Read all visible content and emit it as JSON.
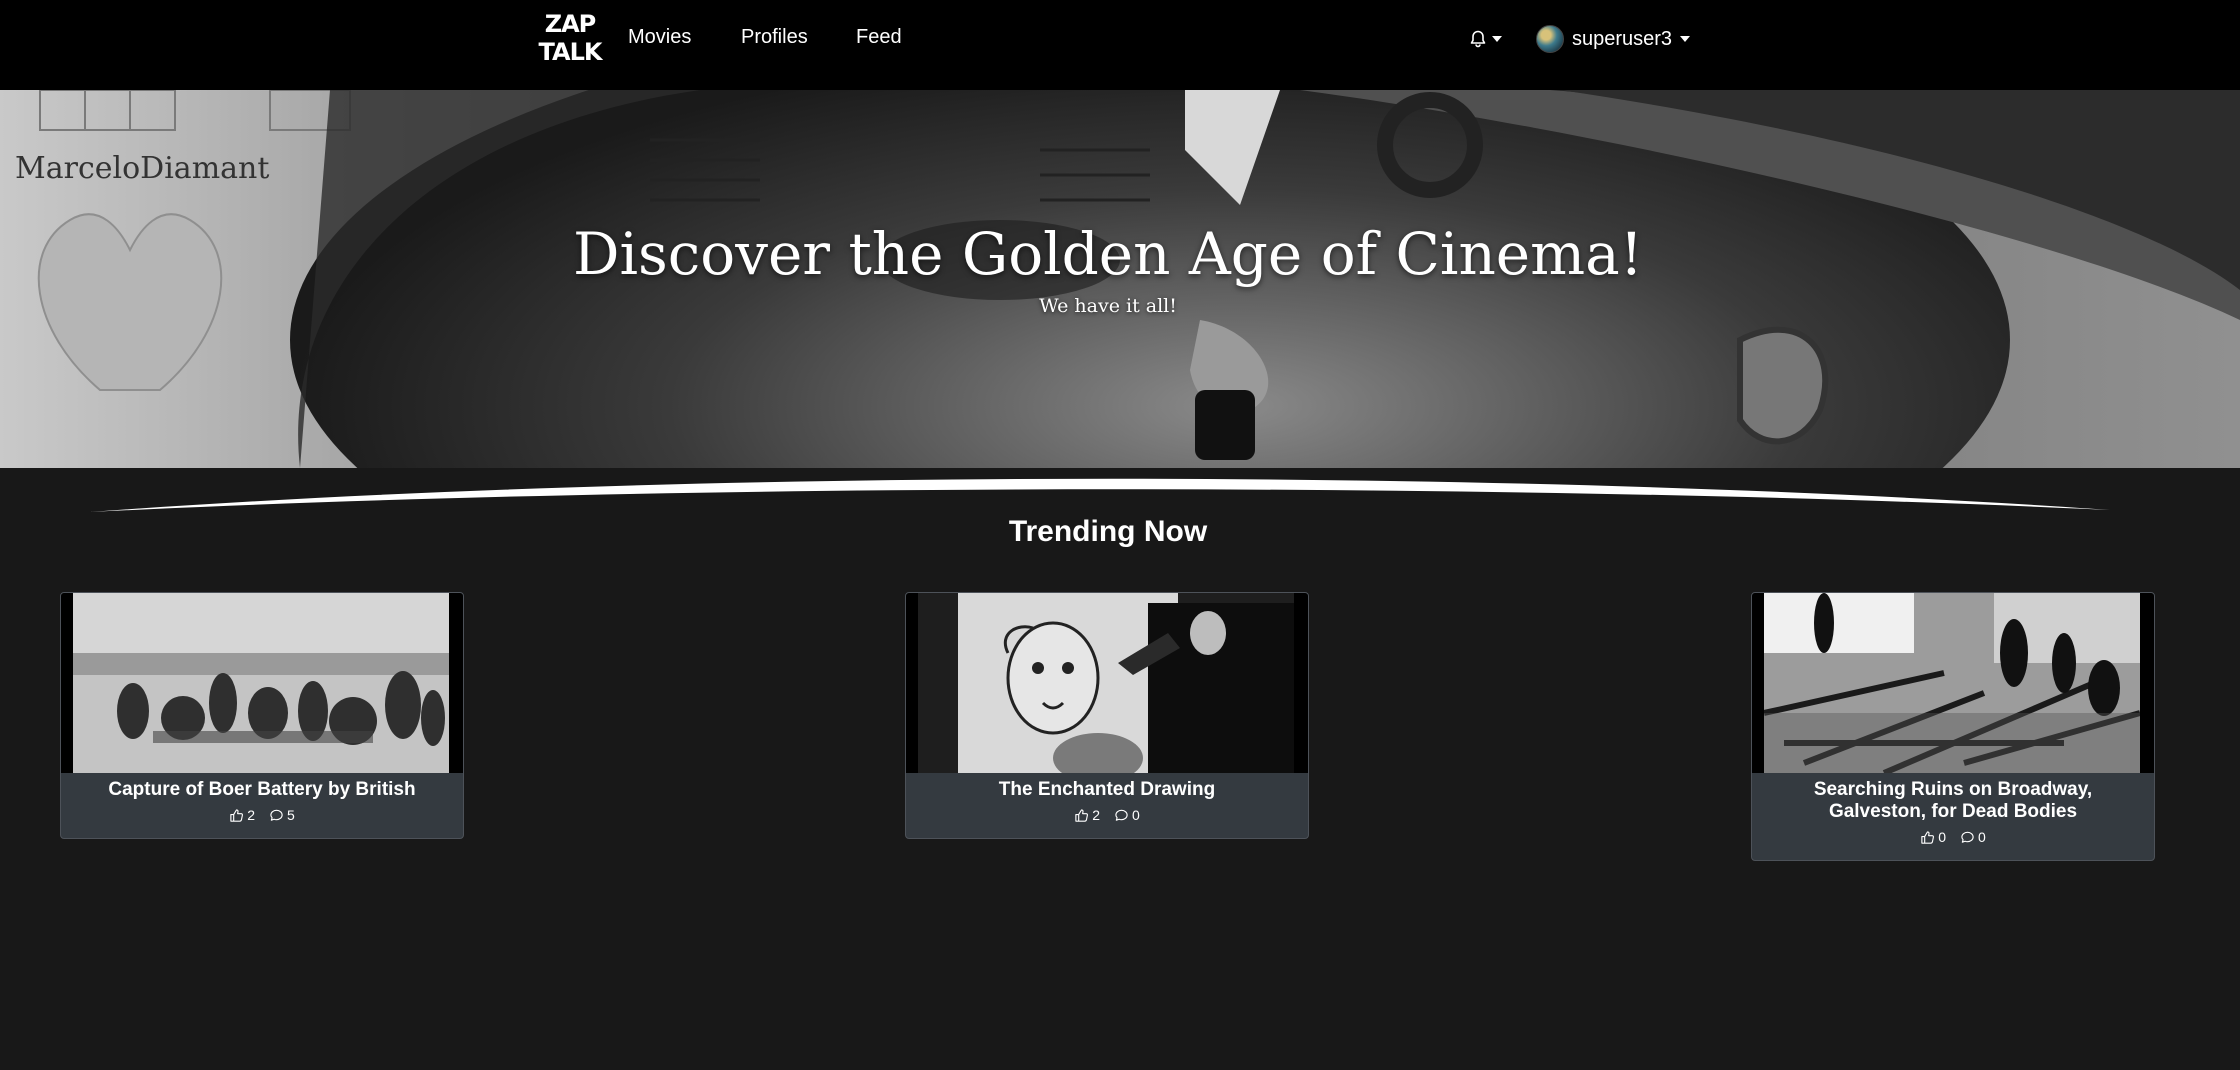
{
  "nav": {
    "logo_top": "ZAP",
    "logo_bottom": "TALK",
    "links": [
      "Movies",
      "Profiles",
      "Feed"
    ],
    "username": "superuser3"
  },
  "hero": {
    "title": "Discover the Golden Age of Cinema!",
    "subtitle": "We have it all!"
  },
  "section": {
    "title": "Trending Now"
  },
  "cards": [
    {
      "title": "Capture of Boer Battery by British",
      "likes": "2",
      "comments": "5"
    },
    {
      "title": "The Enchanted Drawing",
      "likes": "2",
      "comments": "0"
    },
    {
      "title": "Searching Ruins on Broadway, Galveston, for Dead Bodies",
      "likes": "0",
      "comments": "0"
    }
  ],
  "colors": {
    "navbar": "#000000",
    "page_bg": "#181818",
    "card_bg": "#343a40"
  },
  "icons": [
    "bell-icon",
    "thumbs-up-icon",
    "comment-icon",
    "caret-down-icon"
  ]
}
